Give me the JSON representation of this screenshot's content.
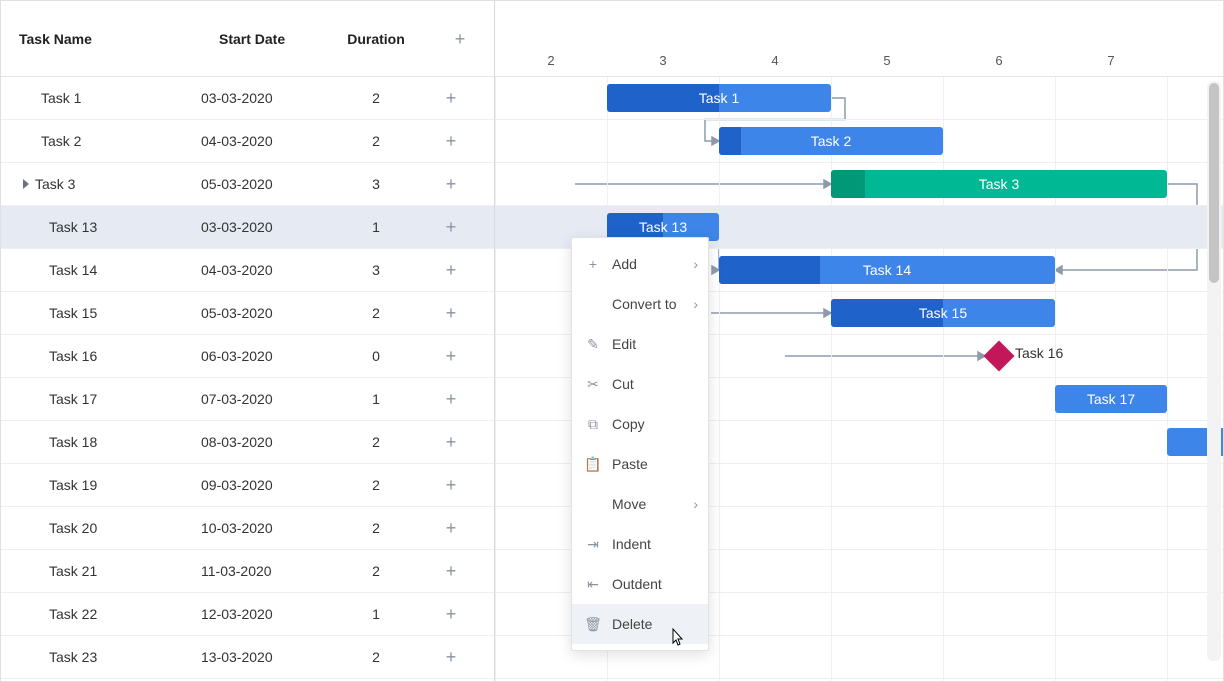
{
  "columns": {
    "name": "Task Name",
    "start": "Start Date",
    "duration": "Duration"
  },
  "timeline": {
    "day_width": 112,
    "origin_day": 2,
    "days": [
      "2",
      "3",
      "4",
      "5",
      "6",
      "7"
    ]
  },
  "tasks": [
    {
      "name": "Task 1",
      "start": "03-03-2020",
      "duration": "2",
      "selected": false,
      "bar": {
        "from": 3,
        "len": 2,
        "prog": 0.5,
        "color": "blue",
        "label": "Task 1"
      }
    },
    {
      "name": "Task 2",
      "start": "04-03-2020",
      "duration": "2",
      "selected": false,
      "bar": {
        "from": 4,
        "len": 2,
        "prog": 0.1,
        "color": "blue",
        "label": "Task 2"
      }
    },
    {
      "name": "Task 3",
      "start": "05-03-2020",
      "duration": "3",
      "selected": false,
      "expandable": true,
      "bar": {
        "from": 5,
        "len": 3,
        "prog": 0.1,
        "color": "green",
        "label": "Task 3"
      }
    },
    {
      "name": "Task 13",
      "start": "03-03-2020",
      "duration": "1",
      "selected": true,
      "indent": true,
      "bar": {
        "from": 3,
        "len": 1,
        "prog": 0.5,
        "color": "blue",
        "label": "Task 13"
      }
    },
    {
      "name": "Task 14",
      "start": "04-03-2020",
      "duration": "3",
      "selected": false,
      "indent": true,
      "bar": {
        "from": 4,
        "len": 3,
        "prog": 0.3,
        "color": "blue",
        "label": "Task 14"
      }
    },
    {
      "name": "Task 15",
      "start": "05-03-2020",
      "duration": "2",
      "selected": false,
      "indent": true,
      "bar": {
        "from": 5,
        "len": 2,
        "prog": 0.5,
        "color": "blue",
        "label": "Task 15"
      }
    },
    {
      "name": "Task 16",
      "start": "06-03-2020",
      "duration": "0",
      "selected": false,
      "indent": true,
      "milestone": {
        "at": 6,
        "label": "Task 16"
      }
    },
    {
      "name": "Task 17",
      "start": "07-03-2020",
      "duration": "1",
      "selected": false,
      "indent": true,
      "bar": {
        "from": 7,
        "len": 1,
        "prog": 0,
        "color": "blue",
        "label": "Task 17"
      }
    },
    {
      "name": "Task 18",
      "start": "08-03-2020",
      "duration": "2",
      "selected": false,
      "indent": true,
      "bar": {
        "from": 8,
        "len": 2,
        "prog": 0,
        "color": "blue",
        "label": ""
      }
    },
    {
      "name": "Task 19",
      "start": "09-03-2020",
      "duration": "2",
      "selected": false,
      "indent": true
    },
    {
      "name": "Task 20",
      "start": "10-03-2020",
      "duration": "2",
      "selected": false,
      "indent": true
    },
    {
      "name": "Task 21",
      "start": "11-03-2020",
      "duration": "2",
      "selected": false,
      "indent": true
    },
    {
      "name": "Task 22",
      "start": "12-03-2020",
      "duration": "1",
      "selected": false,
      "indent": true
    },
    {
      "name": "Task 23",
      "start": "13-03-2020",
      "duration": "2",
      "selected": false,
      "indent": true
    }
  ],
  "context_menu": {
    "items": [
      {
        "label": "Add",
        "icon": "plus",
        "sub": true
      },
      {
        "label": "Convert to",
        "icon": "",
        "sub": true
      },
      {
        "label": "Edit",
        "icon": "pencil"
      },
      {
        "label": "Cut",
        "icon": "scissors"
      },
      {
        "label": "Copy",
        "icon": "copy"
      },
      {
        "label": "Paste",
        "icon": "clipboard"
      },
      {
        "label": "Move",
        "icon": "",
        "sub": true
      },
      {
        "label": "Indent",
        "icon": "indent"
      },
      {
        "label": "Outdent",
        "icon": "outdent"
      },
      {
        "label": "Delete",
        "icon": "trash",
        "hover": true
      }
    ]
  }
}
